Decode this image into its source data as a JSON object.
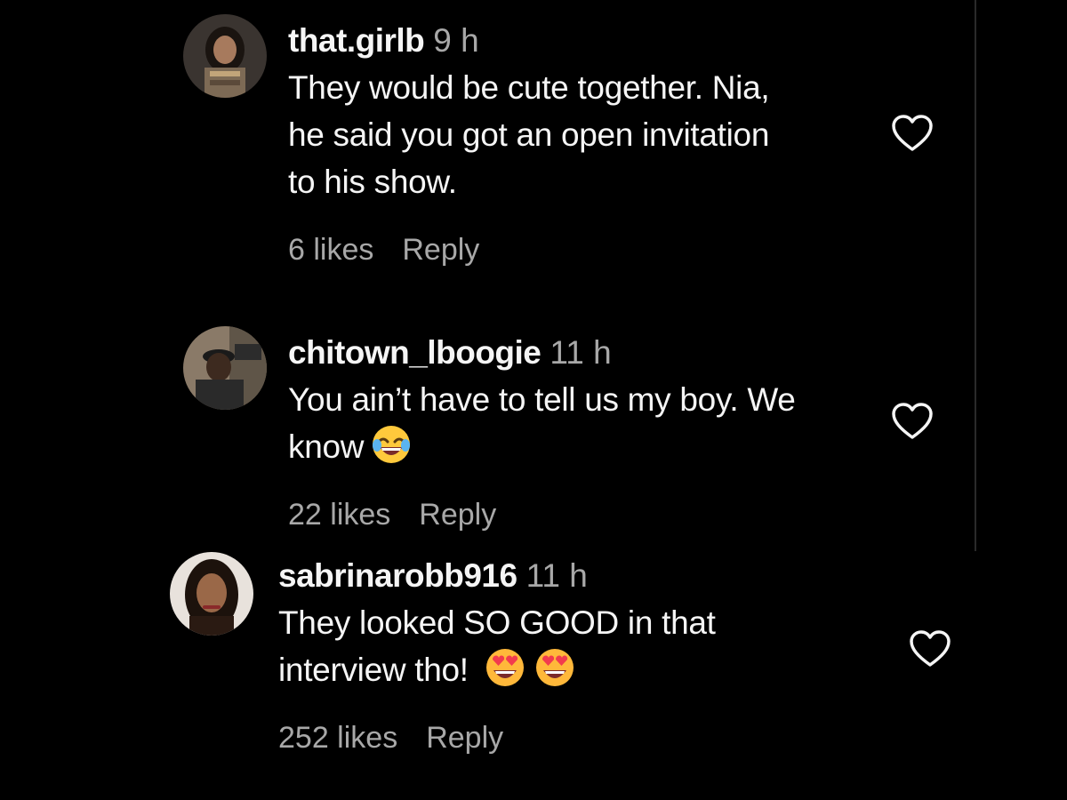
{
  "comments": [
    {
      "username": "that.girlb",
      "time": "9 h",
      "text_lines": [
        "They would be cute together. Nia,",
        "he said you got an open invitation",
        "to his show."
      ],
      "likes": "6 likes",
      "reply_label": "Reply",
      "like_icon": "heart-outline-icon"
    },
    {
      "username": "chitown_lboogie",
      "time": "11 h",
      "text_lines": [
        "You ain’t have to tell us my boy. We",
        "know"
      ],
      "emojis": [
        "face-with-tears-of-joy"
      ],
      "likes": "22 likes",
      "reply_label": "Reply",
      "like_icon": "heart-outline-icon"
    },
    {
      "username": "sabrinarobb916",
      "time": "11 h",
      "text_lines": [
        "They looked SO GOOD in that",
        "interview tho!"
      ],
      "emojis": [
        "smiling-face-with-heart-eyes",
        "smiling-face-with-heart-eyes"
      ],
      "likes": "252 likes",
      "reply_label": "Reply",
      "like_icon": "heart-outline-icon"
    }
  ],
  "colors": {
    "background": "#000000",
    "primary_text": "#f5f5f5",
    "secondary_text": "#a8a8a8"
  }
}
